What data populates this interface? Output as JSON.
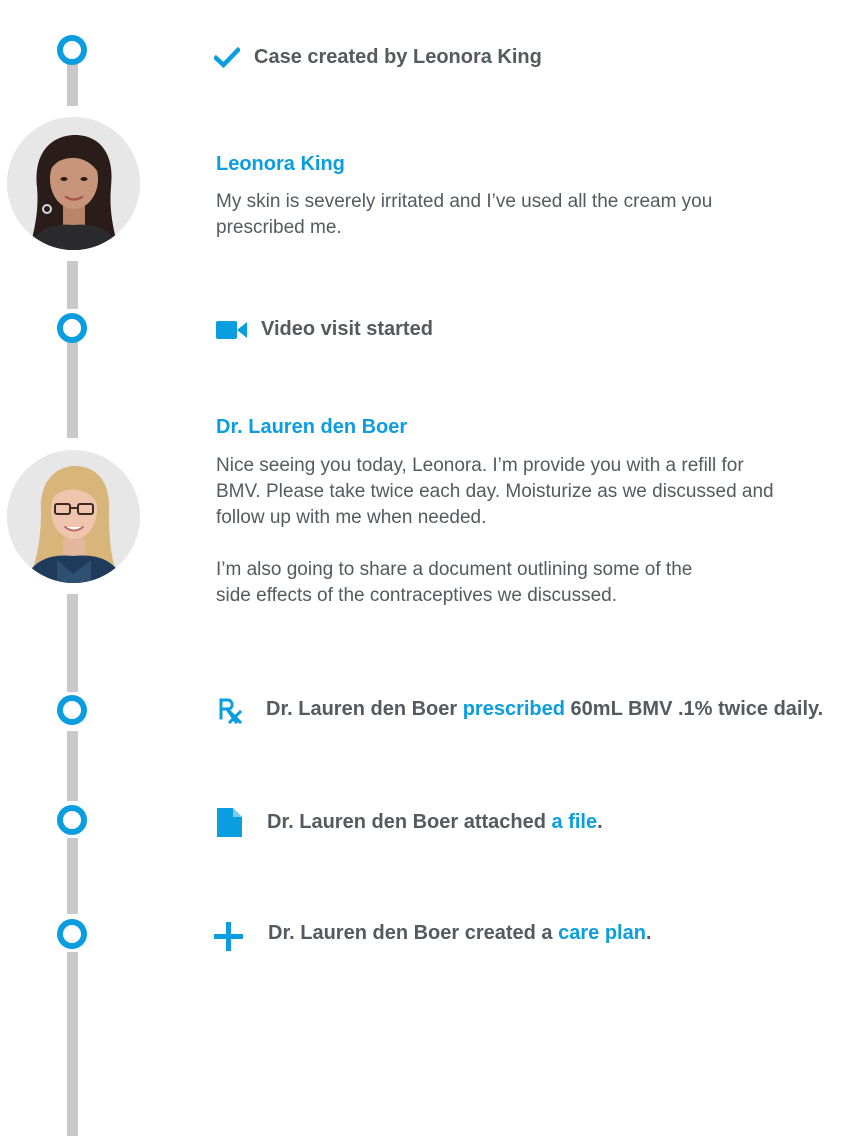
{
  "timeline": {
    "case_created": "Case created by Leonora King",
    "video_visit": "Video visit started",
    "prescribed": {
      "prefix": "Dr. Lauren den Boer ",
      "link": "prescribed",
      "suffix": " 60mL BMV .1% twice daily."
    },
    "attached": {
      "prefix": "Dr. Lauren den Boer attached ",
      "link": "a file",
      "suffix": "."
    },
    "care_plan": {
      "prefix": "Dr. Lauren den Boer created a ",
      "link": "care plan",
      "suffix": "."
    }
  },
  "messages": [
    {
      "author": "Leonora King",
      "text": "My skin is severely irritated and I’ve used all the cream you\nprescribed me.",
      "avatar_icon": "patient-avatar"
    },
    {
      "author": "Dr. Lauren den Boer",
      "paragraph1": "Nice seeing you today, Leonora. I’m provide you with a refill for\nBMV. Please take twice each day. Moisturize as we discussed and\nfollow up with me when needed.",
      "paragraph2": "I’m also going to share a document outlining some of the\nside effects of the contraceptives we discussed.",
      "avatar_icon": "doctor-avatar"
    }
  ],
  "icons": {
    "check": "check-icon",
    "video": "video-camera-icon",
    "rx": "rx-icon",
    "file": "file-icon",
    "plus": "plus-icon"
  },
  "colors": {
    "accent": "#0a9ee0",
    "text": "#555a5f",
    "rail": "#c9c9c9"
  }
}
